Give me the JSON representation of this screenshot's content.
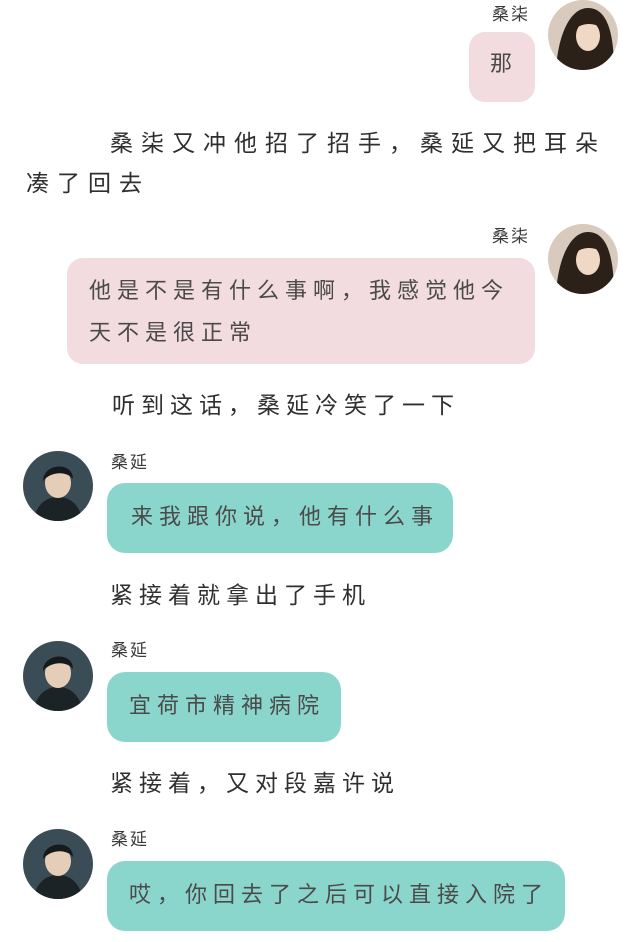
{
  "messages": {
    "m1": {
      "speaker": "桑柒",
      "text": "那"
    },
    "n1": {
      "text": "桑柒又冲他招了招手，桑延又把耳朵凑了回去"
    },
    "m2": {
      "speaker": "桑柒",
      "text": "他是不是有什么事啊，我感觉他今天不是很正常"
    },
    "n2": {
      "text": "听到这话，桑延冷笑了一下"
    },
    "m3": {
      "speaker": "桑延",
      "text": "来我跟你说，他有什么事"
    },
    "n3": {
      "text": "紧接着就拿出了手机"
    },
    "m4": {
      "speaker": "桑延",
      "text": "宜荷市精神病院"
    },
    "n4": {
      "text": "紧接着，又对段嘉许说"
    },
    "m5": {
      "speaker": "桑延",
      "text": "哎，你回去了之后可以直接入院了"
    }
  },
  "icons": {
    "female_avatar": "avatar-female-icon",
    "male_avatar": "avatar-male-icon"
  },
  "colors": {
    "pink_bubble": "#f2dcdf",
    "teal_bubble": "#8bd6cc"
  }
}
